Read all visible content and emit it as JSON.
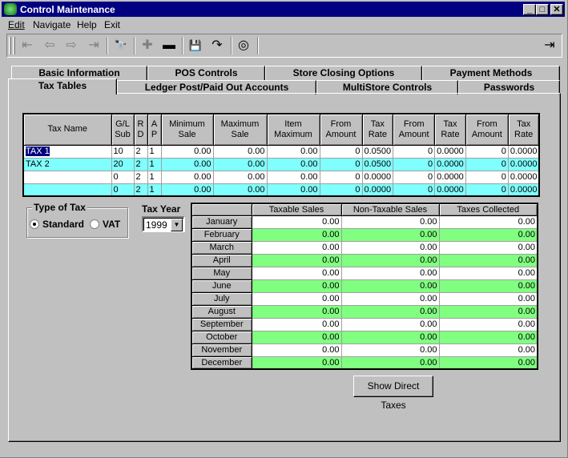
{
  "window": {
    "title": "Control Maintenance",
    "controls": {
      "minimize": "_",
      "maximize": "□",
      "close": "✕"
    }
  },
  "menu": [
    {
      "label": "Edit",
      "accel": "E"
    },
    {
      "label": "Navigate",
      "accel": "N"
    },
    {
      "label": "Help",
      "accel": "H"
    },
    {
      "label": "Exit",
      "accel": "x"
    }
  ],
  "toolbar": {
    "first": "⇤",
    "prev": "⇦",
    "next": "⇨",
    "last": "⇥",
    "find": "🔭",
    "add": "✚",
    "delete": "▬",
    "save": "💾",
    "undo": "↷",
    "help": "◎",
    "exit": "⇥"
  },
  "tabs": {
    "row_back": [
      "Basic Information",
      "POS Controls",
      "Store Closing Options",
      "Payment Methods"
    ],
    "row_front": [
      "Tax Tables",
      "Ledger Post/Paid Out Accounts",
      "MultiStore Controls",
      "Passwords"
    ],
    "active": "Tax Tables"
  },
  "tax_table": {
    "headers": [
      "Tax Name",
      "G/L Sub",
      "R D",
      "A P",
      "Minimum Sale",
      "Maximum Sale",
      "Item Maximum",
      "From Amount",
      "Tax Rate",
      "From Amount",
      "Tax Rate",
      "From Amount",
      "Tax Rate"
    ],
    "rows": [
      [
        "TAX 1",
        "10",
        "2",
        "1",
        "0.00",
        "0.00",
        "0.00",
        "0",
        "0.0500",
        "0",
        "0.0000",
        "0",
        "0.0000"
      ],
      [
        "TAX 2",
        "20",
        "2",
        "1",
        "0.00",
        "0.00",
        "0.00",
        "0",
        "0.0500",
        "0",
        "0.0000",
        "0",
        "0.0000"
      ],
      [
        "",
        "0",
        "2",
        "1",
        "0.00",
        "0.00",
        "0.00",
        "0",
        "0.0000",
        "0",
        "0.0000",
        "0",
        "0.0000"
      ],
      [
        "",
        "0",
        "2",
        "1",
        "0.00",
        "0.00",
        "0.00",
        "0",
        "0.0000",
        "0",
        "0.0000",
        "0",
        "0.0000"
      ]
    ],
    "row_colors": [
      "#ffffff",
      "#80ffff"
    ]
  },
  "type_of_tax": {
    "label": "Type of Tax",
    "options": [
      "Standard",
      "VAT"
    ],
    "selected": "Standard"
  },
  "tax_year": {
    "label": "Tax Year",
    "value": "1999"
  },
  "monthly": {
    "headers": [
      "",
      "Taxable Sales",
      "Non-Taxable Sales",
      "Taxes Collected"
    ],
    "rows": [
      [
        "January",
        "0.00",
        "0.00",
        "0.00"
      ],
      [
        "February",
        "0.00",
        "0.00",
        "0.00"
      ],
      [
        "March",
        "0.00",
        "0.00",
        "0.00"
      ],
      [
        "April",
        "0.00",
        "0.00",
        "0.00"
      ],
      [
        "May",
        "0.00",
        "0.00",
        "0.00"
      ],
      [
        "June",
        "0.00",
        "0.00",
        "0.00"
      ],
      [
        "July",
        "0.00",
        "0.00",
        "0.00"
      ],
      [
        "August",
        "0.00",
        "0.00",
        "0.00"
      ],
      [
        "September",
        "0.00",
        "0.00",
        "0.00"
      ],
      [
        "October",
        "0.00",
        "0.00",
        "0.00"
      ],
      [
        "November",
        "0.00",
        "0.00",
        "0.00"
      ],
      [
        "December",
        "0.00",
        "0.00",
        "0.00"
      ]
    ],
    "row_colors": [
      "#ffffff",
      "#80ff80"
    ]
  },
  "buttons": {
    "show_direct_taxes": "Show Direct Taxes"
  }
}
